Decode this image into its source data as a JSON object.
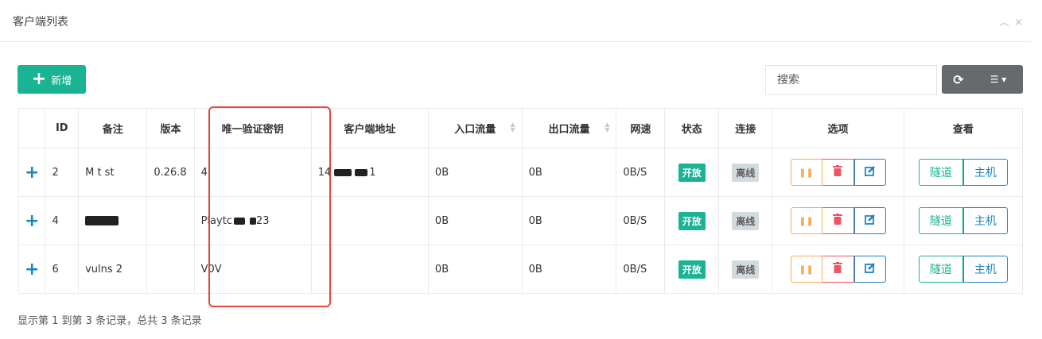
{
  "panel": {
    "title": "客户端列表",
    "collapse_icon": "chevron-up-icon",
    "close_icon": "close-icon"
  },
  "toolbar": {
    "add_label": "新增",
    "search_placeholder": "搜索"
  },
  "table": {
    "headers": [
      "",
      "ID",
      "备注",
      "版本",
      "唯一验证密钥",
      "客户端地址",
      "入口流量",
      "出口流量",
      "网速",
      "状态",
      "连接",
      "选项",
      "查看"
    ],
    "rows": [
      {
        "id": "2",
        "remark": "M    t   st",
        "version": "0.26.8",
        "key": "           4",
        "addr_start": "14",
        "addr_end": "1",
        "in": "0B",
        "out": "0B",
        "speed": "0B/S",
        "status": "开放",
        "conn": "离线"
      },
      {
        "id": "4",
        "remark": "",
        "version": "",
        "key": "Playtc",
        "key_end": "23",
        "addr_start": "",
        "addr_end": "",
        "in": "0B",
        "out": "0B",
        "speed": "0B/S",
        "status": "开放",
        "conn": "离线"
      },
      {
        "id": "6",
        "remark": "vulns   2",
        "version": "",
        "key": "V0V",
        "addr_start": "",
        "addr_end": "",
        "in": "0B",
        "out": "0B",
        "speed": "0B/S",
        "status": "开放",
        "conn": "离线"
      }
    ],
    "view_tunnel_label": "隧道",
    "view_host_label": "主机"
  },
  "footer": {
    "summary": "显示第 1 到第 3 条记录，总共 3 条记录"
  },
  "colors": {
    "primary": "#1ab394",
    "warning": "#f8ac59",
    "danger": "#ed5565",
    "info": "#1c84c6",
    "highlight": "#e8473b"
  }
}
